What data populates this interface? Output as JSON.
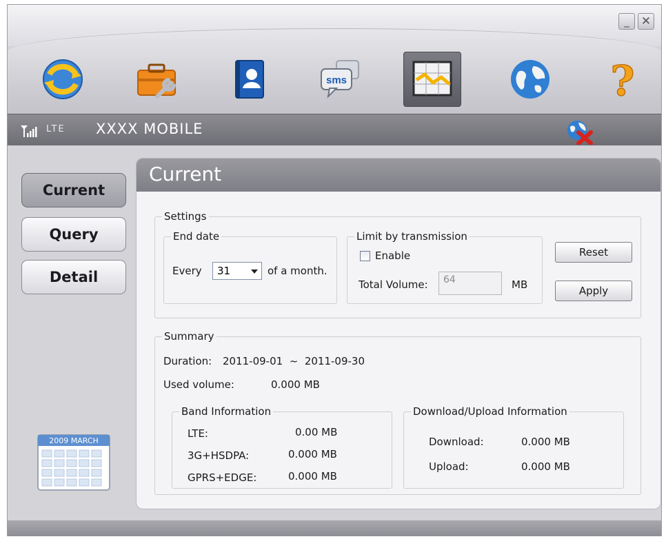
{
  "window": {
    "minimize_glyph": "_",
    "close_glyph": "✕"
  },
  "toolbar": {
    "items": [
      {
        "icon": "connect-icon",
        "active": false
      },
      {
        "icon": "settings-toolbox-icon",
        "active": false
      },
      {
        "icon": "phonebook-icon",
        "active": false
      },
      {
        "icon": "sms-icon",
        "active": false,
        "text": "sms"
      },
      {
        "icon": "statistics-chart-icon",
        "active": true
      },
      {
        "icon": "internet-globe-icon",
        "active": false
      },
      {
        "icon": "help-icon",
        "active": false,
        "text": "?"
      }
    ]
  },
  "status": {
    "network_type": "LTE",
    "operator": "XXXX MOBILE",
    "signal_icon": "signal-strength-icon",
    "disconnect_icon": "disconnect-icon"
  },
  "nav": {
    "items": [
      {
        "label": "Current",
        "selected": true
      },
      {
        "label": "Query",
        "selected": false
      },
      {
        "label": "Detail",
        "selected": false
      }
    ],
    "calendar_text": "2009 MARCH"
  },
  "panel": {
    "title": "Current",
    "settings": {
      "label": "Settings",
      "end_date": {
        "label": "End date",
        "prefix": "Every",
        "day_value": "31",
        "suffix": "of a month."
      },
      "limit": {
        "label": "Limit by transmission",
        "enable_label": "Enable",
        "enable_checked": false,
        "total_volume_label": "Total Volume:",
        "total_volume_value": "64",
        "unit": "MB"
      },
      "reset_label": "Reset",
      "apply_label": "Apply"
    },
    "summary": {
      "label": "Summary",
      "duration_label": "Duration:",
      "duration_value": "2011-09-01  ~  2011-09-30",
      "used_label": "Used volume:",
      "used_value": "0.000 MB",
      "band": {
        "label": "Band Information",
        "rows": [
          {
            "name": "LTE:",
            "value": "0.00 MB"
          },
          {
            "name": "3G+HSDPA:",
            "value": "0.000 MB"
          },
          {
            "name": "GPRS+EDGE:",
            "value": "0.000 MB"
          }
        ]
      },
      "transfer": {
        "label": "Download/Upload Information",
        "rows": [
          {
            "name": "Download:",
            "value": "0.000 MB"
          },
          {
            "name": "Upload:",
            "value": "0.000 MB"
          }
        ]
      }
    }
  },
  "colors": {
    "accent_orange": "#f3a31a",
    "chart_line": "#f4b400",
    "disconnect_red": "#d8231c",
    "globe_blue": "#2f7fd3"
  }
}
